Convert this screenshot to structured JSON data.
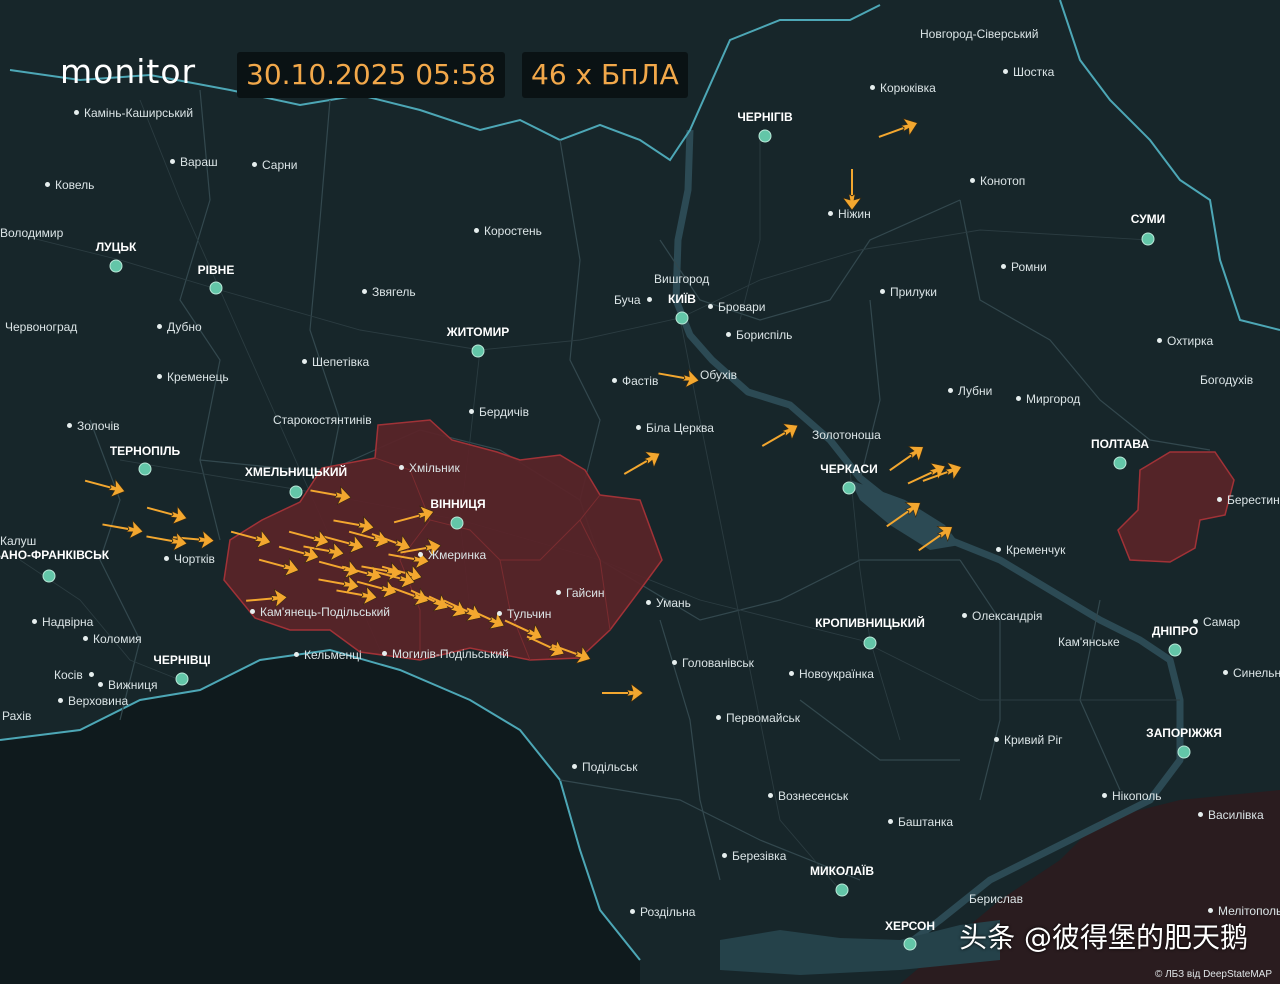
{
  "header": {
    "brand": "monitor",
    "datetime": "30.10.2025 05:58",
    "count": "46 х БпЛА"
  },
  "colors": {
    "background": "#17262a",
    "water": "#2c4a54",
    "border": "#4da7b6",
    "threat_zone": "#5a2428",
    "drone": "#f3a72f",
    "capital_dot": "#63c6a8"
  },
  "capitals": [
    {
      "name": "ЧЕРНІГІВ"
    },
    {
      "name": "СУМИ"
    },
    {
      "name": "ЛУЦЬК"
    },
    {
      "name": "РІВНЕ"
    },
    {
      "name": "КИЇВ"
    },
    {
      "name": "ЖИТОМИР"
    },
    {
      "name": "ТЕРНОПІЛЬ"
    },
    {
      "name": "ХМЕЛЬНИЦЬКИЙ"
    },
    {
      "name": "ВІННИЦЯ"
    },
    {
      "name": "ЧЕРКАСИ"
    },
    {
      "name": "ПОЛТАВА"
    },
    {
      "name": "ІВАНО-ФРАНКІВСЬК"
    },
    {
      "name": "ЧЕРНІВЦІ"
    },
    {
      "name": "КРОПИВНИЦЬКИЙ"
    },
    {
      "name": "ДНІПРО"
    },
    {
      "name": "ЗАПОРІЖЖЯ"
    },
    {
      "name": "МИКОЛАЇВ"
    },
    {
      "name": "ХЕРСОН"
    }
  ],
  "places": [
    "Новгород-Сіверський",
    "Шостка",
    "Корюківка",
    "Конотоп",
    "Ніжин",
    "Ромни",
    "Прилуки",
    "Камінь-Каширський",
    "Вараш",
    "Сарни",
    "Ковель",
    "Володимир",
    "Коростень",
    "Вишгород",
    "Буча",
    "Бровари",
    "Бориспіль",
    "Звягель",
    "Червоноград",
    "Дубно",
    "Шепетівка",
    "Кременець",
    "Фастів",
    "Обухів",
    "Лубни",
    "Миргород",
    "Охтирка",
    "Богодухів",
    "Бердичів",
    "Старокостянтинів",
    "Золочів",
    "Біла Церква",
    "Золотоноша",
    "Хмільник",
    "Калуш",
    "Чортків",
    "Жмеринка",
    "Гайсин",
    "Умань",
    "Кременчук",
    "Берестин",
    "Кам'янець-Подільський",
    "Тульчин",
    "Надвірна",
    "Коломия",
    "Олександрія",
    "Самар",
    "Кам'янське",
    "Кельменці",
    "Могилів-Подільський",
    "Косів",
    "Вижниця",
    "Верховина",
    "Рахів",
    "Голованівськ",
    "Новоукраїнка",
    "Синельникове",
    "Первомайськ",
    "Кривий Ріг",
    "Подільськ",
    "Вознесенськ",
    "Нікополь",
    "Василівка",
    "Баштанка",
    "Березівка",
    "Берислав",
    "Роздільна",
    "Мелітополь"
  ],
  "watermark": "头条 @彼得堡的肥天鹅",
  "credit": "© ЛБЗ від DeepStateMAP"
}
